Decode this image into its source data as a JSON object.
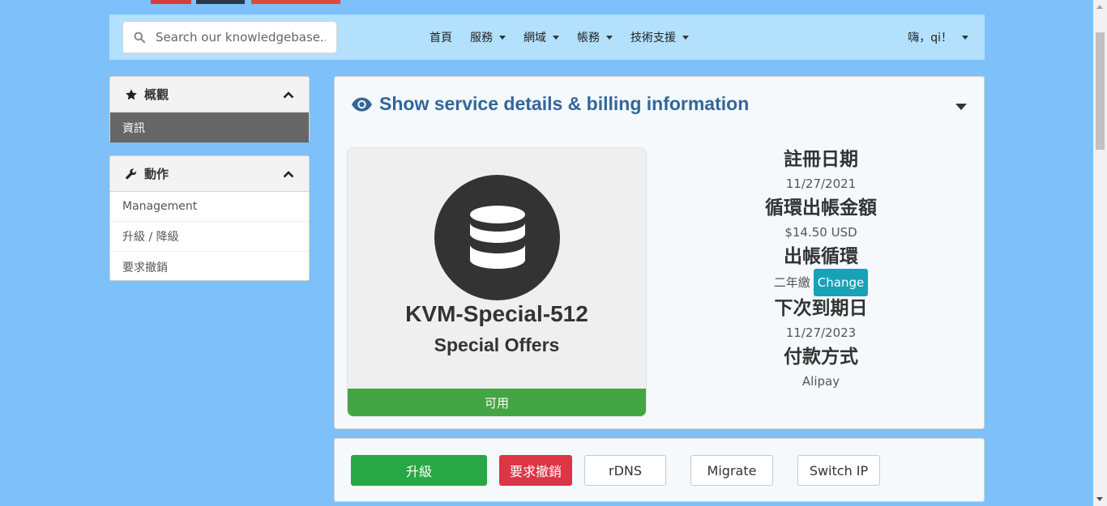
{
  "nav": {
    "search_placeholder": "Search our knowledgebase...",
    "items": [
      {
        "label": "首頁",
        "dropdown": false
      },
      {
        "label": "服務",
        "dropdown": true
      },
      {
        "label": "網域",
        "dropdown": true
      },
      {
        "label": "帳務",
        "dropdown": true
      },
      {
        "label": "技術支援",
        "dropdown": true
      }
    ],
    "user_greeting": "嗨，qi！"
  },
  "sidebar": {
    "overview": {
      "title": "概觀",
      "items": [
        {
          "label": "資訊",
          "active": true
        }
      ]
    },
    "actions": {
      "title": "動作",
      "items": [
        {
          "label": "Management"
        },
        {
          "label": "升級 / 降級"
        },
        {
          "label": "要求撤銷"
        }
      ]
    }
  },
  "service": {
    "toggle_title": "Show service details & billing information",
    "product_name": "KVM-Special-512",
    "product_group": "Special Offers",
    "status": "可用",
    "details": {
      "reg_date_label": "註冊日期",
      "reg_date": "11/27/2021",
      "recurring_label": "循環出帳金額",
      "recurring": "$14.50 USD",
      "cycle_label": "出帳循環",
      "cycle": "二年繳",
      "change_label": "Change",
      "next_due_label": "下次到期日",
      "next_due": "11/27/2023",
      "payment_label": "付款方式",
      "payment": "Alipay"
    }
  },
  "actions": {
    "upgrade": "升級",
    "cancel": "要求撤銷",
    "rdns": "rDNS",
    "migrate": "Migrate",
    "switch_ip": "Switch IP"
  },
  "colors": {
    "page_bg": "#7ec0f9",
    "nav_bg": "#b3e0fc",
    "title_blue": "#336699",
    "status_green": "#44a544",
    "upgrade_green": "#28a745",
    "cancel_red": "#dc3545",
    "change_teal": "#17a2b8"
  }
}
